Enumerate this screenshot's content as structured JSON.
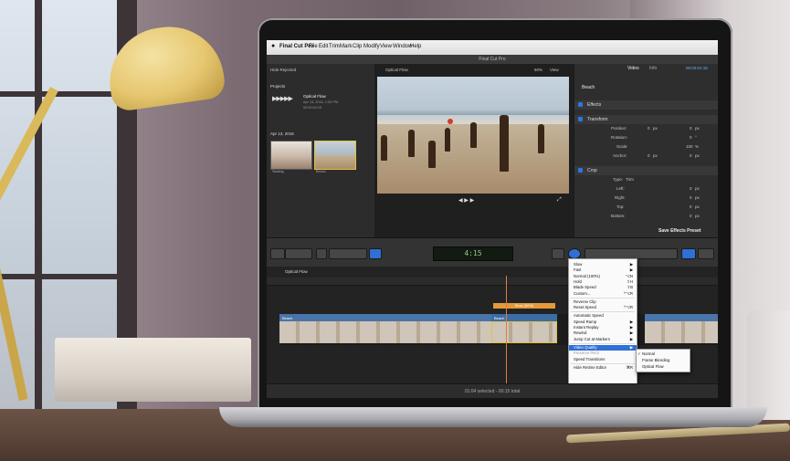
{
  "app": {
    "name": "Final Cut Pro",
    "window_title": "Final Cut Pro",
    "menu": [
      "File",
      "Edit",
      "Trim",
      "Mark",
      "Clip",
      "Modify",
      "View",
      "Window",
      "Help"
    ]
  },
  "browser": {
    "library": "Hide Rejected",
    "projects_header": "Projects",
    "project": {
      "name": "Optical Flow",
      "date": "Apr 13, 2016, 1:53 PM",
      "duration": "00:00:00:15"
    },
    "event_header": "Apr 13, 2016",
    "thumbs": [
      {
        "label": "Skating"
      },
      {
        "label": "Beach"
      }
    ],
    "page": "1 of 3 sele..."
  },
  "viewer": {
    "title": "Optical Flow",
    "zoom": "60%",
    "view": "View"
  },
  "inspector": {
    "tabs": [
      "Video",
      "Info"
    ],
    "timecode": "00:00:01:15",
    "clip_name": "Beach",
    "sections": {
      "effects": "Effects",
      "transform": "Transform",
      "crop": "Crop"
    },
    "rows": [
      {
        "label": "Position:",
        "x": "0",
        "y": "0",
        "unit": "px"
      },
      {
        "label": "Rotation:",
        "value": "0",
        "unit": "°"
      },
      {
        "label": "Scale:",
        "value": "100",
        "unit": "%"
      },
      {
        "label": "Anchor:",
        "x": "0",
        "y": "0",
        "unit": "px"
      }
    ],
    "crop": {
      "type_label": "Type:",
      "type_value": "Trim",
      "fields": [
        {
          "label": "Left:",
          "value": "0",
          "unit": "px"
        },
        {
          "label": "Right:",
          "value": "0",
          "unit": "px"
        },
        {
          "label": "Top:",
          "value": "0",
          "unit": "px"
        },
        {
          "label": "Bottom:",
          "value": "0",
          "unit": "px"
        }
      ]
    },
    "save_preset": "Save Effects Preset"
  },
  "toolbar": {
    "timecode": "4:15"
  },
  "timeline": {
    "project_name": "Optical Flow",
    "clips": [
      {
        "name": "Beach"
      },
      {
        "name": "Beach"
      },
      {
        "name": "Slow (50%)"
      }
    ]
  },
  "context_menu": {
    "items": [
      {
        "label": "Slow",
        "key": "",
        "type": "submenu"
      },
      {
        "label": "Fast",
        "key": "",
        "type": "submenu"
      },
      {
        "label": "Normal (100%)",
        "key": "⌥N",
        "type": "normal"
      },
      {
        "label": "Hold",
        "key": "⇧H",
        "type": "normal"
      },
      {
        "label": "Blade Speed",
        "key": "⇧B",
        "type": "normal"
      },
      {
        "label": "Custom...",
        "key": "^⌥R",
        "type": "normal"
      },
      {
        "label": "Reverse Clip",
        "key": "",
        "type": "normal"
      },
      {
        "label": "Reset Speed",
        "key": "^⌥R",
        "type": "normal"
      },
      {
        "label": "Automatic Speed",
        "key": "",
        "type": "normal"
      },
      {
        "label": "Speed Ramp",
        "key": "",
        "type": "submenu"
      },
      {
        "label": "Instant Replay",
        "key": "",
        "type": "submenu"
      },
      {
        "label": "Rewind",
        "key": "",
        "type": "submenu"
      },
      {
        "label": "Jump Cut at Markers",
        "key": "",
        "type": "submenu"
      },
      {
        "label": "Video Quality",
        "key": "",
        "type": "highlight"
      },
      {
        "label": "Preserve Pitch",
        "key": "",
        "type": "disabled"
      },
      {
        "label": "Speed Transitions",
        "key": "",
        "type": "normal"
      },
      {
        "label": "Hide Retime Editor",
        "key": "⌘R",
        "type": "normal"
      }
    ],
    "submenu": [
      {
        "label": "Normal",
        "checked": true
      },
      {
        "label": "Frame Blending",
        "checked": false
      },
      {
        "label": "Optical Flow",
        "checked": false
      }
    ]
  },
  "status": {
    "text": "01:04 selected - 00:15 total"
  }
}
